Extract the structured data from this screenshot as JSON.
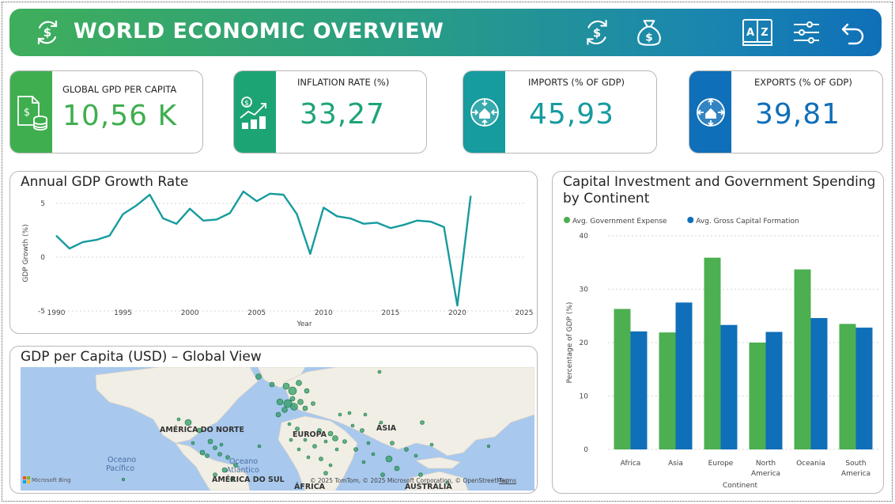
{
  "header": {
    "title": "WORLD ECONOMIC OVERVIEW",
    "icons": [
      "currency-exchange-icon",
      "money-bag-icon",
      "dictionary-icon",
      "filter-sliders-icon",
      "back-arrow-icon"
    ]
  },
  "kpis": [
    {
      "label": "GLOBAL GPD PER CAPITA",
      "value": "10,56 K",
      "color": "#3fae4f",
      "icon": "document-dollar-icon"
    },
    {
      "label": "INFLATION RATE (%)",
      "value": "33,27",
      "color": "#1da475",
      "icon": "growth-coins-icon"
    },
    {
      "label": "IMPORTS (% OF GDP)",
      "value": "45,93",
      "color": "#169b9e",
      "icon": "imports-arrows-icon"
    },
    {
      "label": "EXPORTS (% OF GDP)",
      "value": "39,81",
      "color": "#0f6fb8",
      "icon": "exports-arrows-icon"
    }
  ],
  "line_panel": {
    "title": "Annual GDP Growth Rate"
  },
  "bar_panel": {
    "title_line1": "Capital Investment and Government Spending",
    "title_line2": "by Continent"
  },
  "map_panel": {
    "title": "GDP per Capita (USD) – Global View",
    "labels": {
      "north_america": "AMÉRICA DO NORTE",
      "europe": "EUROPA",
      "asia": "ÁSIA",
      "africa": "ÁFRICA",
      "south_america": "AMÉRICA DO SUL",
      "australia": "AUSTRÁLIA",
      "pacific_line1": "Oceano",
      "pacific_line2": "Pacífico",
      "atlantic_line1": "Oceano",
      "atlantic_line2": "Atlântico",
      "ocean_partial": "Oceano"
    },
    "attribution": "© 2025 TomTom, © 2025 Microsoft Corporation, © OpenStreetMap",
    "terms": "Terms",
    "bing": "Microsoft Bing"
  },
  "chart_data": [
    {
      "type": "line",
      "title": "Annual GDP Growth Rate",
      "xlabel": "Year",
      "ylabel": "GDP Growth (%)",
      "xlim": [
        1990,
        2025
      ],
      "ylim": [
        -5,
        5
      ],
      "xticks": [
        1990,
        1995,
        2000,
        2005,
        2010,
        2015,
        2020,
        2025
      ],
      "yticks": [
        -5,
        0,
        5
      ],
      "color": "#169b9e",
      "x": [
        1990,
        1991,
        1992,
        1993,
        1994,
        1995,
        1996,
        1997,
        1998,
        1999,
        2000,
        2001,
        2002,
        2003,
        2004,
        2005,
        2006,
        2007,
        2008,
        2009,
        2010,
        2011,
        2012,
        2013,
        2014,
        2015,
        2016,
        2017,
        2018,
        2019,
        2020,
        2021
      ],
      "y": [
        2.0,
        0.8,
        1.4,
        1.6,
        2.0,
        4.0,
        4.8,
        5.8,
        3.6,
        3.1,
        4.5,
        3.4,
        3.5,
        4.1,
        6.1,
        5.2,
        5.9,
        5.8,
        4.0,
        0.3,
        4.6,
        3.8,
        3.6,
        3.1,
        3.2,
        2.7,
        3.0,
        3.4,
        3.3,
        2.8,
        -4.5,
        5.7
      ]
    },
    {
      "type": "bar",
      "title": "Capital Investment and Government Spending by Continent",
      "xlabel": "Continent",
      "ylabel": "Percentage of GDP (%)",
      "ylim": [
        0,
        40
      ],
      "yticks": [
        0,
        10,
        20,
        30,
        40
      ],
      "categories": [
        "Africa",
        "Asia",
        "Europe",
        "North America",
        "Oceania",
        "South America"
      ],
      "category_lines": [
        [
          "Africa"
        ],
        [
          "Asia"
        ],
        [
          "Europe"
        ],
        [
          "North",
          "America"
        ],
        [
          "Oceania"
        ],
        [
          "South",
          "America"
        ]
      ],
      "legend_position": "top-left",
      "series": [
        {
          "name": "Avg. Government Expense",
          "color": "#4caf50",
          "values": [
            26.3,
            21.9,
            35.9,
            20.0,
            33.7,
            23.5
          ]
        },
        {
          "name": "Avg. Gross Capital Formation",
          "color": "#0f6fb8",
          "values": [
            22.1,
            27.5,
            23.3,
            22.0,
            24.6,
            22.8
          ]
        }
      ]
    }
  ]
}
